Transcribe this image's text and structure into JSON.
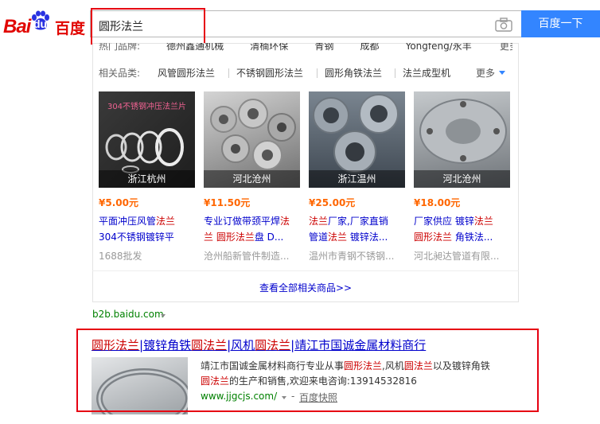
{
  "header": {
    "logo_bai": "Bai",
    "logo_du": "du",
    "logo_cn": "百度",
    "search_value": "圆形法兰",
    "search_button": "百度一下"
  },
  "card": {
    "row1": {
      "label": "热门品牌:",
      "items": [
        "德州鑫通机械",
        "清楠环保",
        "青钢",
        "成都",
        "Yongfeng/永丰"
      ],
      "more": "更多"
    },
    "row2": {
      "label": "相关品类:",
      "items": [
        "风管圆形法兰",
        "不锈钢圆形法兰",
        "圆形角铁法兰",
        "法兰成型机"
      ],
      "more": "更多"
    },
    "products": [
      {
        "img_caption": "304不锈钢冲压法兰片",
        "location": "浙江杭州",
        "price": "¥5.00元",
        "title_l1": [
          "平面冲压风管",
          "法兰"
        ],
        "title_l2": [
          "304不锈钢镀锌平",
          ""
        ],
        "seller": "1688批发"
      },
      {
        "location": "河北沧州",
        "price": "¥11.50元",
        "title_l1": [
          "专业订做带颈平焊",
          "法"
        ],
        "title_l2_em1": "兰",
        "title_l2_em2": "圆形法兰",
        "title_l2_tail": "盘 D...",
        "seller": "沧州船新管件制造..."
      },
      {
        "location": "浙江温州",
        "price": "¥25.00元",
        "title_l1_em": "法兰",
        "title_l1_tail": "厂家,厂家直销",
        "title_l2_head": "管道",
        "title_l2_em": "法兰",
        "title_l2_tail": " 镀锌法...",
        "seller": "温州市青钢不锈钢..."
      },
      {
        "location": "河北沧州",
        "price": "¥18.00元",
        "title_l1_head": "厂家供应 镀锌",
        "title_l1_em": "法兰",
        "title_l2_em": "圆形法兰",
        "title_l2_tail": " 角铁法...",
        "seller": "河北昶达管道有限..."
      }
    ],
    "view_all": "查看全部相关商品>>"
  },
  "b2b_url": "b2b.baidu.com",
  "result": {
    "title_parts": [
      {
        "t": "圆形法兰",
        "em": true
      },
      {
        "t": "|镀锌角铁",
        "em": false
      },
      {
        "t": "圆法兰",
        "em": true
      },
      {
        "t": "|风机",
        "em": false
      },
      {
        "t": "圆法兰",
        "em": true
      },
      {
        "t": "|靖江市国诚金属材料商行",
        "em": false
      }
    ],
    "desc_l1_a": "靖江市国诚金属材料商行专业从事",
    "desc_l1_b": "圆形法兰",
    "desc_l1_c": ",风机",
    "desc_l1_d": "圆法兰",
    "desc_l1_e": "以及镀锌角铁",
    "desc_l2_a": "圆法兰",
    "desc_l2_b": "的生产和销售,欢迎来电咨询:13914532816",
    "url": "www.jjgcjs.com/",
    "snapshot": "百度快照",
    "dash": "-"
  },
  "colors": {
    "brand_red": "#e10601",
    "button_blue": "#3385ff",
    "highlight_red": "#e60012",
    "link_blue": "#0000cc",
    "url_green": "#008000",
    "price_orange": "#ff6600"
  }
}
